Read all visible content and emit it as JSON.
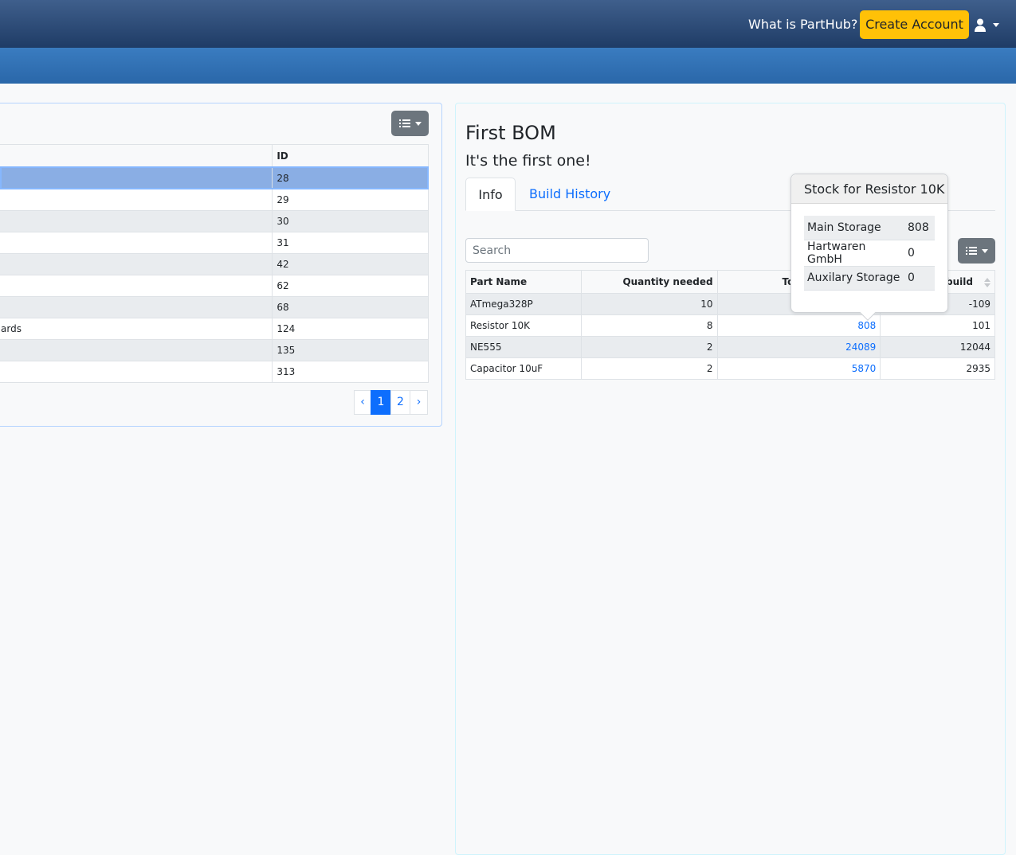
{
  "navbar": {
    "about_link": "What is PartHub?",
    "create_account": "Create Account",
    "user_icon": "user-icon"
  },
  "left_table": {
    "header_id": "ID",
    "rows": [
      {
        "name": "",
        "id": "28"
      },
      {
        "name": "",
        "id": "29"
      },
      {
        "name": "",
        "id": "30"
      },
      {
        "name": "",
        "id": "31"
      },
      {
        "name": "",
        "id": "42"
      },
      {
        "name": "",
        "id": "62"
      },
      {
        "name": "",
        "id": "68"
      },
      {
        "name": "ards",
        "id": "124"
      },
      {
        "name": "",
        "id": "135"
      },
      {
        "name": "",
        "id": "313"
      }
    ],
    "selected_color": "#8aaee4"
  },
  "pagination": {
    "prev": "‹",
    "pages": [
      "1",
      "2"
    ],
    "next": "›",
    "active": "1"
  },
  "bom": {
    "title": "First BOM",
    "description": "It's the first one!",
    "tabs": [
      "Info",
      "Build History"
    ],
    "search_placeholder": "Search",
    "columns": [
      "Part Name",
      "Quantity needed",
      "To",
      "build"
    ],
    "rows": [
      {
        "part": "ATmega328P",
        "qty": "10",
        "total": "",
        "build": "-109"
      },
      {
        "part": "Resistor 10K",
        "qty": "8",
        "total": "808",
        "build": "101"
      },
      {
        "part": "NE555",
        "qty": "2",
        "total": "24089",
        "build": "12044"
      },
      {
        "part": "Capacitor 10uF",
        "qty": "2",
        "total": "5870",
        "build": "2935"
      }
    ]
  },
  "popover": {
    "title": "Stock for Resistor 10K",
    "rows": [
      {
        "location": "Main Storage",
        "qty": "808"
      },
      {
        "location": "Hartwaren GmbH",
        "qty": "0"
      },
      {
        "location": "Auxilary Storage",
        "qty": "0"
      }
    ]
  },
  "colors": {
    "primary": "#0d6efd",
    "warning": "#ffc107",
    "secondary": "#6c757d"
  }
}
